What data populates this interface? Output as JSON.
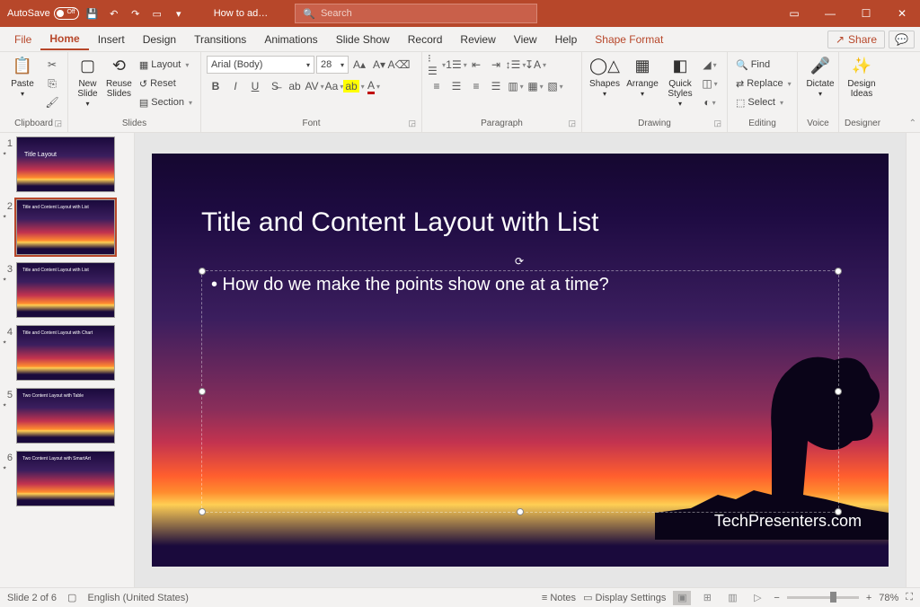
{
  "titlebar": {
    "autosave_label": "AutoSave",
    "autosave_state": "Off",
    "doc_title": "How to ad…",
    "search_placeholder": "Search"
  },
  "window_controls": {
    "min": "—",
    "max": "☐",
    "close": "✕",
    "ribbon_mode": "▭"
  },
  "menu": {
    "file": "File",
    "home": "Home",
    "insert": "Insert",
    "design": "Design",
    "transitions": "Transitions",
    "animations": "Animations",
    "slideshow": "Slide Show",
    "record": "Record",
    "review": "Review",
    "view": "View",
    "help": "Help",
    "shape_format": "Shape Format",
    "share": "Share"
  },
  "ribbon": {
    "clipboard": {
      "label": "Clipboard",
      "paste": "Paste"
    },
    "slides": {
      "label": "Slides",
      "new_slide": "New\nSlide",
      "reuse_slides": "Reuse\nSlides",
      "layout": "Layout",
      "reset": "Reset",
      "section": "Section"
    },
    "font": {
      "label": "Font",
      "name": "Arial (Body)",
      "size": "28"
    },
    "paragraph": {
      "label": "Paragraph"
    },
    "drawing": {
      "label": "Drawing",
      "shapes": "Shapes",
      "arrange": "Arrange",
      "quick_styles": "Quick\nStyles"
    },
    "editing": {
      "label": "Editing",
      "find": "Find",
      "replace": "Replace",
      "select": "Select"
    },
    "voice": {
      "label": "Voice",
      "dictate": "Dictate"
    },
    "designer": {
      "label": "Designer",
      "design_ideas": "Design\nIdeas"
    }
  },
  "thumbnails": [
    {
      "num": "1",
      "title": "Title Layout"
    },
    {
      "num": "2",
      "title": "Title and Content Layout with List"
    },
    {
      "num": "3",
      "title": "Title and Content Layout with List"
    },
    {
      "num": "4",
      "title": "Title and Content Layout with Chart"
    },
    {
      "num": "5",
      "title": "Two Content Layout with Table"
    },
    {
      "num": "6",
      "title": "Two Content Layout with SmartArt"
    }
  ],
  "slide": {
    "title": "Title and Content Layout with List",
    "bullet1": "• How do we make the points show one at a time?",
    "watermark": "TechPresenters.com"
  },
  "status": {
    "slide_info": "Slide 2 of 6",
    "language": "English (United States)",
    "notes": "Notes",
    "display_settings": "Display Settings",
    "zoom": "78%"
  }
}
